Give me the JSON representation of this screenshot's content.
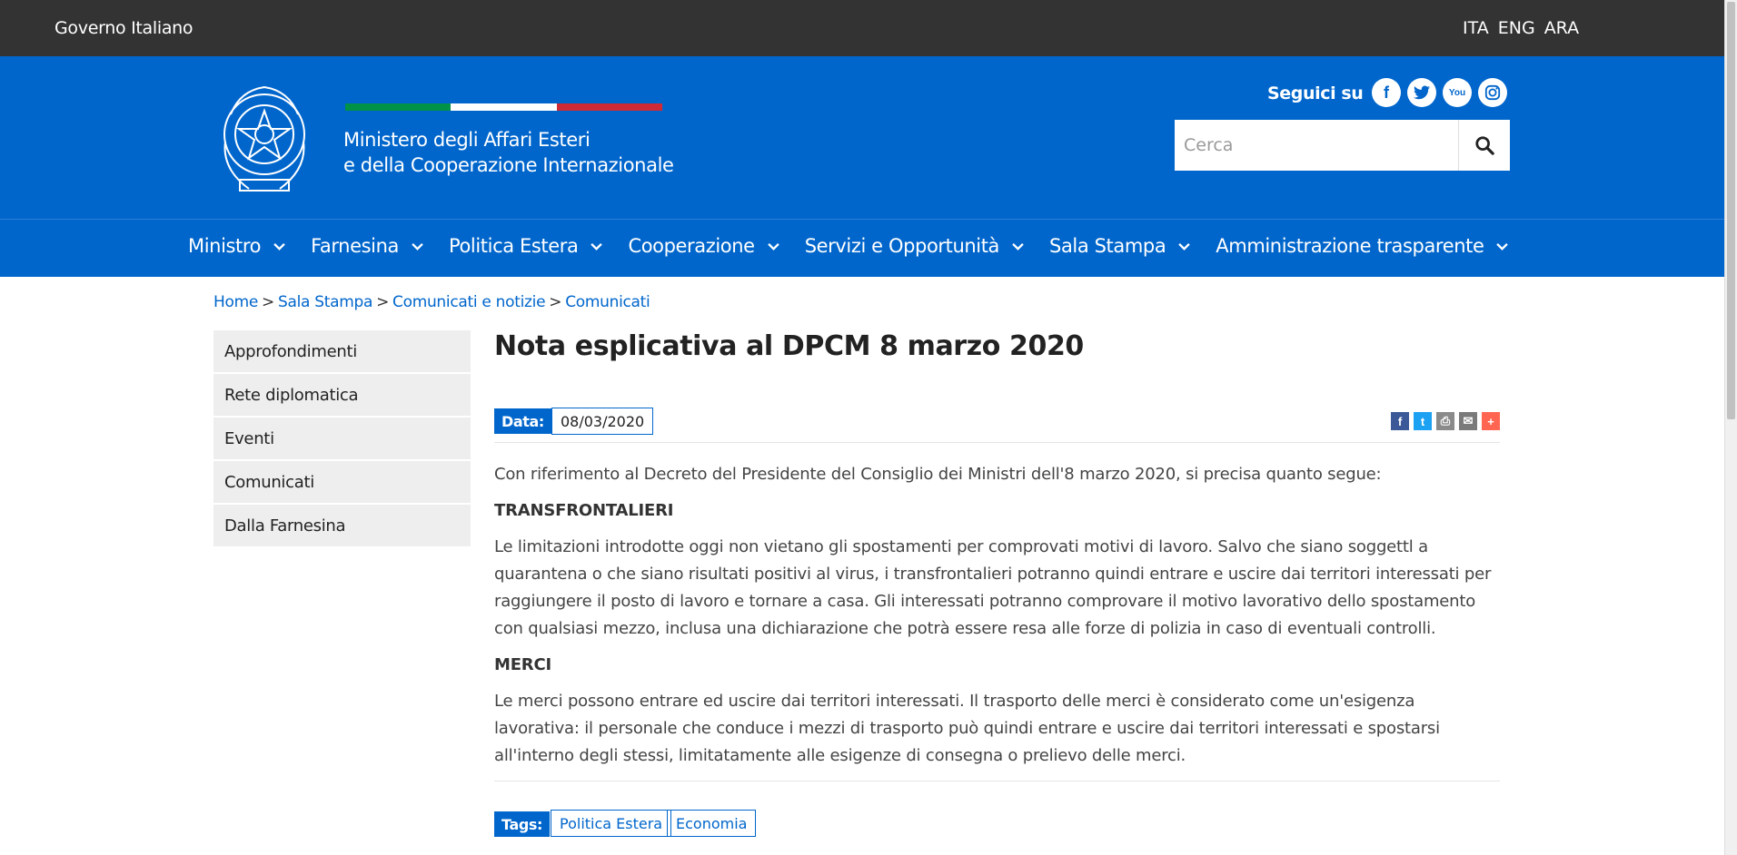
{
  "topbar": {
    "government": "Governo Italiano",
    "languages": [
      "ITA",
      "ENG",
      "ARA"
    ]
  },
  "header": {
    "ministry_line1": "Ministero degli Affari Esteri",
    "ministry_line2": "e della Cooperazione Internazionale",
    "follow_label": "Seguici su",
    "socials": [
      "facebook-icon",
      "twitter-icon",
      "youtube-icon",
      "instagram-icon"
    ],
    "search_placeholder": "Cerca",
    "flag_colors": [
      "#009246",
      "#ffffff",
      "#ce2b37"
    ]
  },
  "nav": {
    "items": [
      {
        "label": "Ministro"
      },
      {
        "label": "Farnesina"
      },
      {
        "label": "Politica Estera"
      },
      {
        "label": "Cooperazione"
      },
      {
        "label": "Servizi e Opportunità"
      },
      {
        "label": "Sala Stampa"
      },
      {
        "label": "Amministrazione trasparente"
      }
    ]
  },
  "breadcrumb": [
    "Home",
    "Sala Stampa",
    "Comunicati e notizie",
    "Comunicati"
  ],
  "sidebar": {
    "items": [
      "Approfondimenti",
      "Rete diplomatica",
      "Eventi",
      "Comunicati",
      "Dalla Farnesina"
    ]
  },
  "article": {
    "title": "Nota esplicativa al DPCM 8 marzo 2020",
    "date_label": "Data:",
    "date_value": "08/03/2020",
    "intro": "Con riferimento al Decreto del Presidente del Consiglio dei Ministri dell'8 marzo 2020, si precisa quanto segue:",
    "heading1": "TRANSFRONTALIERI",
    "para1": "Le limitazioni introdotte oggi non vietano gli spostamenti per comprovati motivi di lavoro. Salvo che siano soggettl a quarantena o che siano risultati positivi al virus, i transfrontalieri potranno quindi entrare e uscire dai territori interessati per raggiungere il posto di lavoro e tornare a casa. Gli interessati potranno comprovare il motivo lavorativo dello spostamento con qualsiasi mezzo, inclusa una dichiarazione che potrà essere resa alle forze di polizia in caso di eventuali controlli.",
    "heading2": "MERCI",
    "para2": "Le merci possono entrare ed uscire dai territori interessati. Il trasporto delle merci è considerato come un'esigenza lavorativa: il personale che conduce i mezzi di trasporto può quindi entrare e uscire dai territori interessati e spostarsi all'interno degli stessi, limitatamente alle esigenze di consegna o prelievo delle merci.",
    "tags_label": "Tags:",
    "tags": [
      "Politica Estera",
      "Economia"
    ],
    "share": [
      {
        "icon": "facebook-share-icon",
        "color": "#3b5998"
      },
      {
        "icon": "twitter-share-icon",
        "color": "#1da1f2"
      },
      {
        "icon": "print-share-icon",
        "color": "#8a8a8a"
      },
      {
        "icon": "email-share-icon",
        "color": "#7a7a7a"
      },
      {
        "icon": "more-share-icon",
        "color": "#ff6550"
      }
    ]
  }
}
